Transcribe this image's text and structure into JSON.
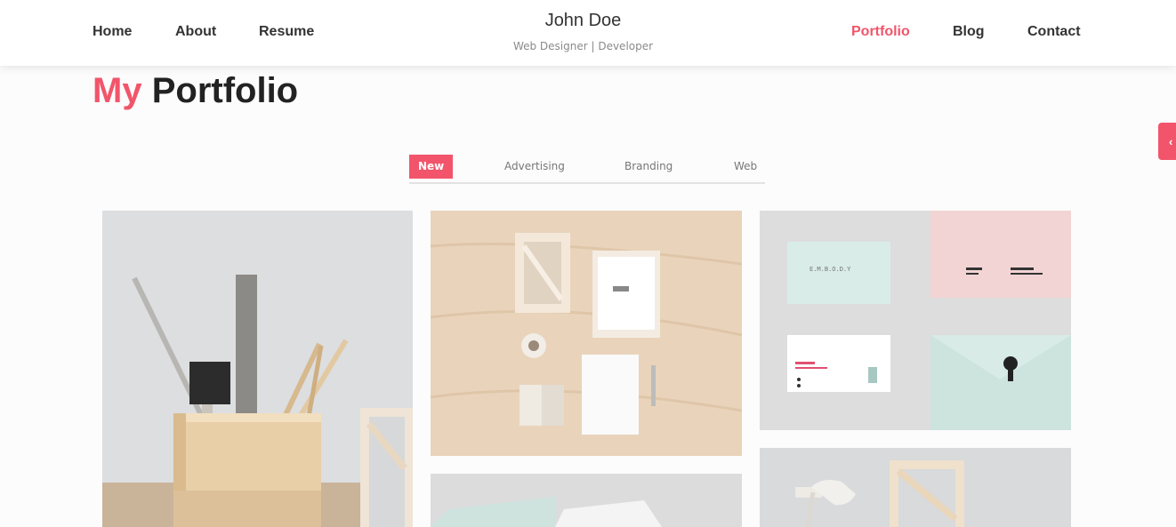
{
  "nav": {
    "left": [
      {
        "label": "Home"
      },
      {
        "label": "About"
      },
      {
        "label": "Resume"
      }
    ],
    "right": [
      {
        "label": "Portfolio",
        "active": true
      },
      {
        "label": "Blog"
      },
      {
        "label": "Contact"
      }
    ]
  },
  "brand": {
    "name": "John Doe",
    "tagline": "Web Designer | Developer"
  },
  "page": {
    "title_accent": "My",
    "title_rest": "Portfolio"
  },
  "filters": {
    "active": "New",
    "items": [
      "New",
      "Advertising",
      "Branding",
      "Web"
    ]
  },
  "side_toggle_icon": "chevron-left-icon",
  "colors": {
    "accent": "#f2556b",
    "header_bg": "#ffffff",
    "page_bg": "#fcfcfc"
  },
  "portfolio_items": [
    {
      "name": "pencil-holder-photo"
    },
    {
      "name": "stationery-flatlay-photo"
    },
    {
      "name": "business-cards-photo"
    },
    {
      "name": "mint-envelope-photo"
    },
    {
      "name": "desk-lamp-photo"
    }
  ]
}
